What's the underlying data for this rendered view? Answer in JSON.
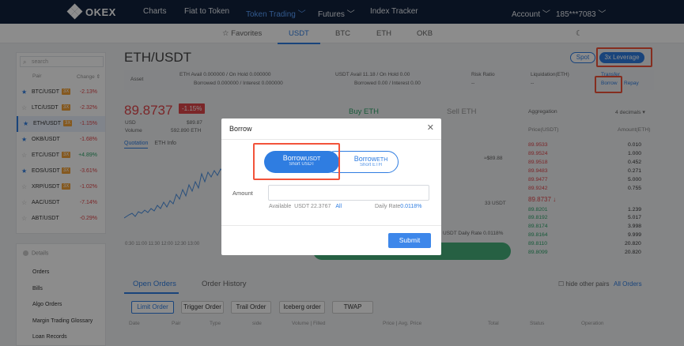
{
  "topnav": {
    "logo": "OKEX",
    "items": [
      "Charts",
      "Fiat to Token",
      "Token Trading",
      "Futures",
      "Index Tracker"
    ],
    "account": "Account",
    "phone": "185***7083"
  },
  "subnav": {
    "favorites": "Favorites",
    "tabs": [
      "USDT",
      "BTC",
      "ETH",
      "OKB"
    ]
  },
  "left": {
    "search_placeholder": "search",
    "col_pair": "Pair",
    "col_change": "Change",
    "leverage_badge": "3X",
    "pairs": [
      {
        "name": "BTC/USDT",
        "change": "-2.13%",
        "starred": true
      },
      {
        "name": "LTC/USDT",
        "change": "-2.32%",
        "starred": false
      },
      {
        "name": "ETH/USDT",
        "change": "-1.15%",
        "starred": true
      },
      {
        "name": "OKB/USDT",
        "change": "-1.68%",
        "starred": true
      },
      {
        "name": "ETC/USDT",
        "change": "+4.89%",
        "starred": false
      },
      {
        "name": "EOS/USDT",
        "change": "-3.61%",
        "starred": true
      },
      {
        "name": "XRP/USDT",
        "change": "-1.02%",
        "starred": false
      },
      {
        "name": "AAC/USDT",
        "change": "-7.14%",
        "starred": false
      },
      {
        "name": "ABT/USDT",
        "change": "-0.29%",
        "starred": false
      }
    ],
    "menu_head": "Details",
    "menu": [
      "Orders",
      "Bills",
      "Algo Orders",
      "Margin Trading Glossary",
      "Loan Records"
    ]
  },
  "main": {
    "pair_title": "ETH/USDT",
    "spot": "Spot",
    "leverage": "3x Leverage",
    "asset": {
      "label": "Asset",
      "eth_line1": "ETH   Avail   0.000000   /  On Hold  0.000000",
      "eth_line2": "Borrowed   0.000000  /  Interest  0.000000",
      "usdt_line1": "USDT  Avail   11.18  /  On Hold  0.00",
      "usdt_line2": "Borrowed   0.00  /  Interest  0.00",
      "risk_label": "Risk Ratio",
      "risk_val": "--",
      "liq_label": "Liquidation(ETH)",
      "liq_val": "--",
      "transfer": "Transfer",
      "borrow": "Borrow",
      "repay": "Repay"
    },
    "price": "89.8737",
    "change_pct": "-1.15%",
    "usd_label": "USD",
    "usd_val": "$89.87",
    "volume_label": "Volume",
    "volume_val": "592.890 ETH",
    "chart_tabs": [
      "Quotation",
      "ETH Info"
    ],
    "time_labels": "0:30   11:00   11:30   12:00   12:30   13:00",
    "buy_tab": "Buy ETH",
    "sell_tab": "Sell ETH",
    "approx": "≈$89.88",
    "usdt_frag": "33 USDT",
    "rate_frag": "USDT Daily Rate 0.0118%"
  },
  "orderbook": {
    "aggregation": "Aggregation",
    "decimals": "4 decimals",
    "col_price": "Price(USDT)",
    "col_amount": "Amount(ETH)",
    "asks": [
      {
        "price": "89.9533",
        "amount": "0.010"
      },
      {
        "price": "89.9524",
        "amount": "1.000"
      },
      {
        "price": "89.9518",
        "amount": "0.452"
      },
      {
        "price": "89.9483",
        "amount": "0.271"
      },
      {
        "price": "89.9477",
        "amount": "5.000"
      },
      {
        "price": "89.9242",
        "amount": "0.755"
      }
    ],
    "last": "89.8737",
    "bids": [
      {
        "price": "89.8201",
        "amount": "1.239"
      },
      {
        "price": "89.8192",
        "amount": "5.017"
      },
      {
        "price": "89.8174",
        "amount": "3.998"
      },
      {
        "price": "89.8164",
        "amount": "9.999"
      },
      {
        "price": "89.8110",
        "amount": "20.820"
      },
      {
        "price": "89.8099",
        "amount": "20.820"
      }
    ]
  },
  "bottom": {
    "open_orders": "Open Orders",
    "order_history": "Order History",
    "hide_other": "hide other pairs",
    "all_orders": "All Orders",
    "order_types": [
      "Limit Order",
      "Trigger Order",
      "Trail Order",
      "Iceberg order",
      "TWAP"
    ],
    "cols": [
      "Date",
      "Pair",
      "Type",
      "side",
      "Volume | Filled",
      "Price | Avg. Price",
      "Total",
      "Status",
      "Operation"
    ]
  },
  "modal": {
    "title": "Borrow",
    "seg_usdt_main": "Borrow",
    "seg_usdt_cur": "USDT",
    "seg_usdt_sub": "Short USDT",
    "seg_eth_main": "Borrow",
    "seg_eth_cur": "ETH",
    "seg_eth_sub": "Short ETH",
    "amount_label": "Amount",
    "amount_value": "",
    "available_label": "Available",
    "available_value": "USDT 22.3767",
    "all": "All",
    "daily_rate_label": "Daily Rate",
    "daily_rate_value": "0.0118%",
    "submit": "Submit"
  },
  "colors": {
    "accent": "#2f7de1",
    "highlight": "#f2533a",
    "up": "#2ea56a",
    "down": "#e0464a"
  }
}
